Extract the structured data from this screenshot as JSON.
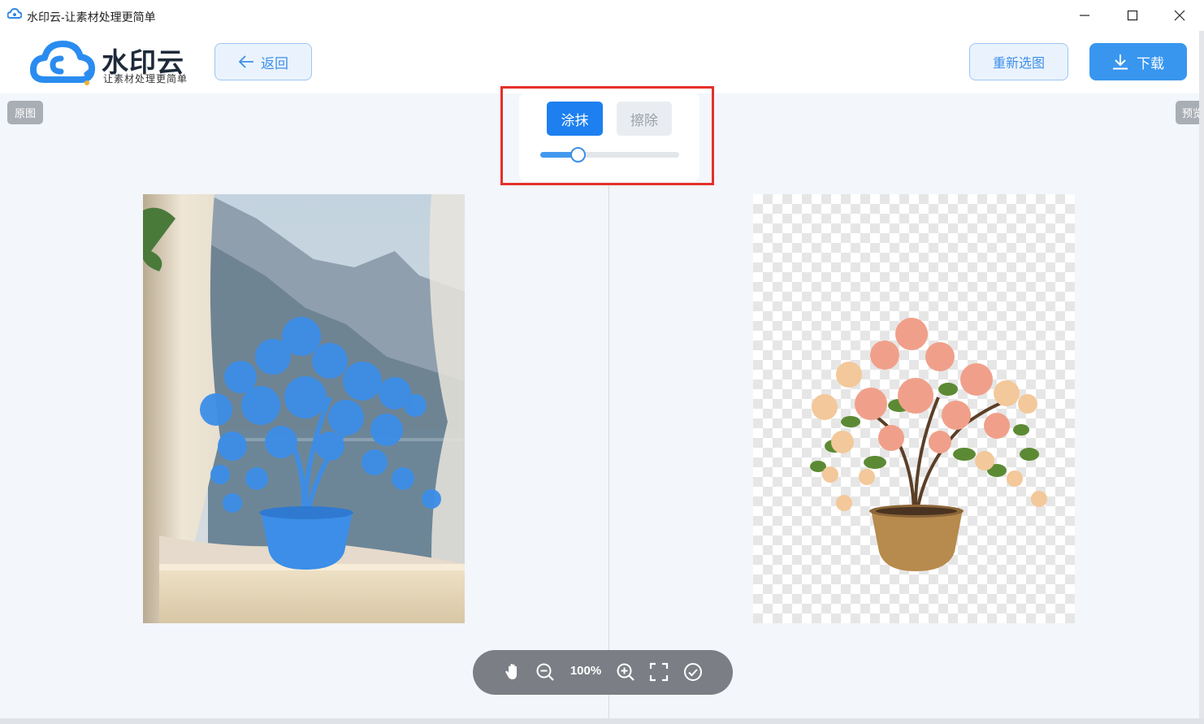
{
  "window": {
    "title": "水印云-让素材处理更简单"
  },
  "header": {
    "brand": "水印云",
    "slogan": "让素材处理更简单",
    "back_label": "返回",
    "reselect_label": "重新选图",
    "download_label": "下载"
  },
  "panels": {
    "original_tag": "原图",
    "preview_tag": "预览"
  },
  "brush": {
    "smear_label": "涂抹",
    "erase_label": "擦除",
    "active_tool": "smear",
    "size_fraction": 0.27
  },
  "zoom": {
    "level": "100%"
  },
  "colors": {
    "accent": "#1d7ff0",
    "highlight_border": "#e5302a",
    "toolbar_bg": "#7b7f85"
  },
  "icons": {
    "hand": "hand-icon",
    "zoom_out": "zoom-out-icon",
    "zoom_in": "zoom-in-icon",
    "fit": "fullscreen-icon",
    "confirm": "check-circle-icon"
  }
}
